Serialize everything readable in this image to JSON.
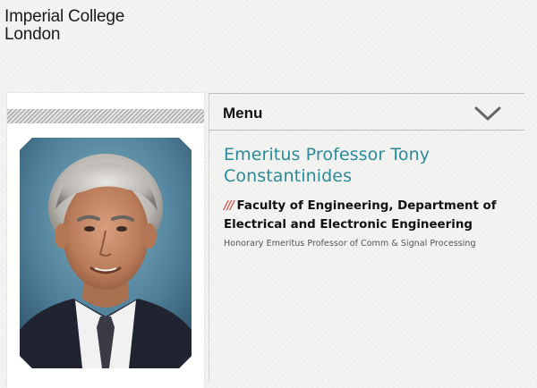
{
  "logo": {
    "line1": "Imperial College",
    "line2": "London"
  },
  "menu": {
    "label": "Menu",
    "icon": "chevron-down-icon"
  },
  "profile": {
    "name": "Emeritus Professor Tony Constantinides",
    "slashes": "///",
    "department": "Faculty of Engineering, Department of Electrical and Electronic Engineering",
    "role": "Honorary Emeritus Professor of Comm & Signal Processing"
  },
  "colors": {
    "accent_teal": "#2a8a9a",
    "slash_red": "#d2352c",
    "background": "#f4f4f2"
  }
}
